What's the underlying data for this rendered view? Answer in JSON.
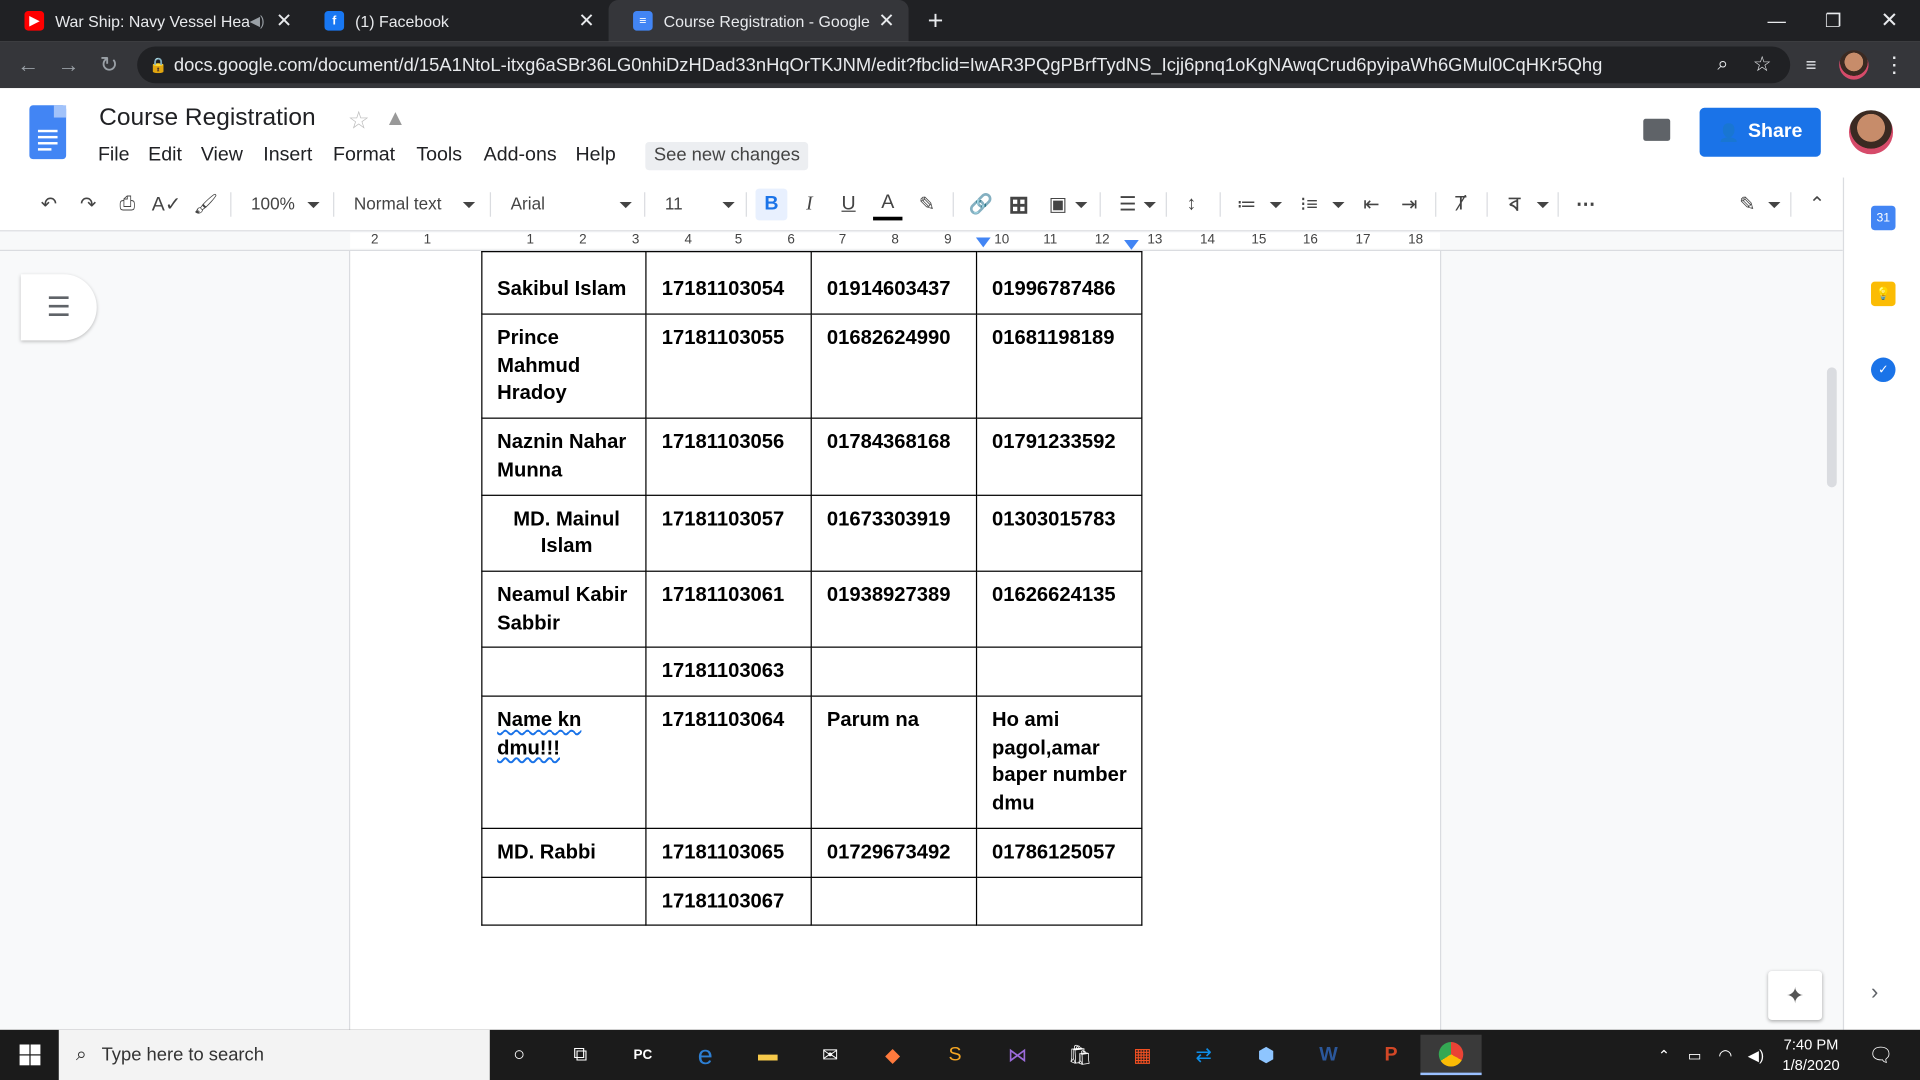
{
  "browser": {
    "tabs": [
      {
        "title": "War Ship: Navy Vessel Heavy",
        "icon": "youtube-icon",
        "color": "#ff0000"
      },
      {
        "title": "(1) Facebook",
        "icon": "facebook-icon",
        "color": "#1877f2"
      },
      {
        "title": "Course Registration - Google Do",
        "icon": "docs-icon",
        "color": "#4285f4"
      }
    ],
    "url": "docs.google.com/document/d/15A1NtoL-itxg6aSBr36LG0nhiDzHDad33nHqOrTKJNM/edit?fbclid=IwAR3PQgPBrfTydNS_Icjj6pnq1oKgNAwqCrud6pyipaWh6GMul0CqHKr5Qhg"
  },
  "doc": {
    "title": "Course Registration",
    "menu": [
      "File",
      "Edit",
      "View",
      "Insert",
      "Format",
      "Tools",
      "Add-ons",
      "Help"
    ],
    "see_new_changes": "See new changes",
    "share_label": "Share"
  },
  "toolbar": {
    "zoom": "100%",
    "style": "Normal text",
    "font": "Arial",
    "size": "11"
  },
  "ruler": [
    "2",
    "1",
    "1",
    "2",
    "3",
    "4",
    "5",
    "6",
    "7",
    "8",
    "9",
    "10",
    "11",
    "12",
    "13",
    "14",
    "15",
    "16",
    "17",
    "18"
  ],
  "table": {
    "rows": [
      [
        "Sakibul Islam",
        "17181103054",
        "01914603437",
        "01996787486"
      ],
      [
        "Prince Mahmud Hradoy",
        "17181103055",
        "01682624990",
        "01681198189"
      ],
      [
        "Naznin Nahar Munna",
        "17181103056",
        "01784368168",
        "01791233592"
      ],
      [
        "MD. Mainul Islam",
        "17181103057",
        "01673303919",
        "01303015783"
      ],
      [
        "Neamul Kabir Sabbir",
        "17181103061",
        "01938927389",
        "01626624135"
      ],
      [
        "",
        "17181103063",
        "",
        ""
      ],
      [
        "Name kn dmu!!!",
        "17181103064",
        "Parum na",
        "Ho ami pagol,amar baper number dmu"
      ],
      [
        "MD. Rabbi",
        "17181103065",
        "01729673492",
        "01786125057"
      ],
      [
        "",
        "17181103067",
        "",
        ""
      ]
    ]
  },
  "taskbar": {
    "search_placeholder": "Type here to search",
    "time": "7:40 PM",
    "date": "1/8/2020"
  }
}
